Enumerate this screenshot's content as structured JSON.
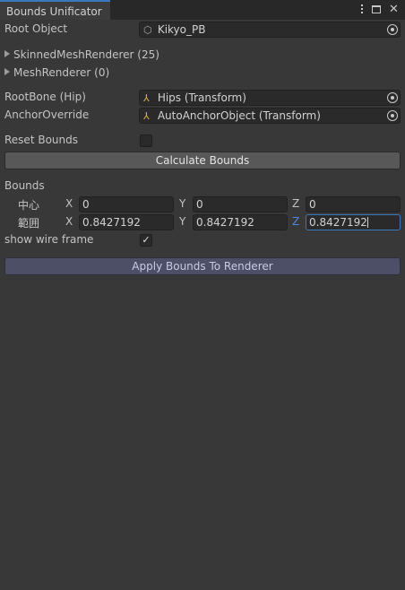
{
  "window": {
    "tab_title": "Bounds Unificator",
    "icons": [
      "kebab-menu-icon",
      "maximize-icon",
      "close-icon"
    ]
  },
  "root_object": {
    "label": "Root Object",
    "value": "Kikyo_PB",
    "icon": "gameobject-cube-icon"
  },
  "foldouts": [
    {
      "label": "SkinnedMeshRenderer (25)"
    },
    {
      "label": "MeshRenderer (0)"
    }
  ],
  "root_bone": {
    "label": "RootBone (Hip)",
    "value": "Hips (Transform)",
    "icon": "transform-axes-icon"
  },
  "anchor_override": {
    "label": "AnchorOverride",
    "value": "AutoAnchorObject (Transform)",
    "icon": "transform-axes-icon"
  },
  "reset_bounds": {
    "label": "Reset Bounds",
    "checked": false
  },
  "calculate_button": "Calculate Bounds",
  "bounds": {
    "label": "Bounds",
    "center": {
      "label": "中心",
      "x_label": "X",
      "y_label": "Y",
      "z_label": "Z",
      "x": "0",
      "y": "0",
      "z": "0"
    },
    "extent": {
      "label": "範囲",
      "x_label": "X",
      "y_label": "Y",
      "z_label": "Z",
      "x": "0.8427192",
      "y": "0.8427192",
      "z": "0.8427192"
    }
  },
  "show_wire_frame": {
    "label": "show wire frame",
    "checked": true,
    "check_glyph": "✓"
  },
  "apply_button": "Apply Bounds To Renderer",
  "colors": {
    "accent": "#3a79bb",
    "active_axis": "#4a8ad9",
    "background": "#383838"
  }
}
